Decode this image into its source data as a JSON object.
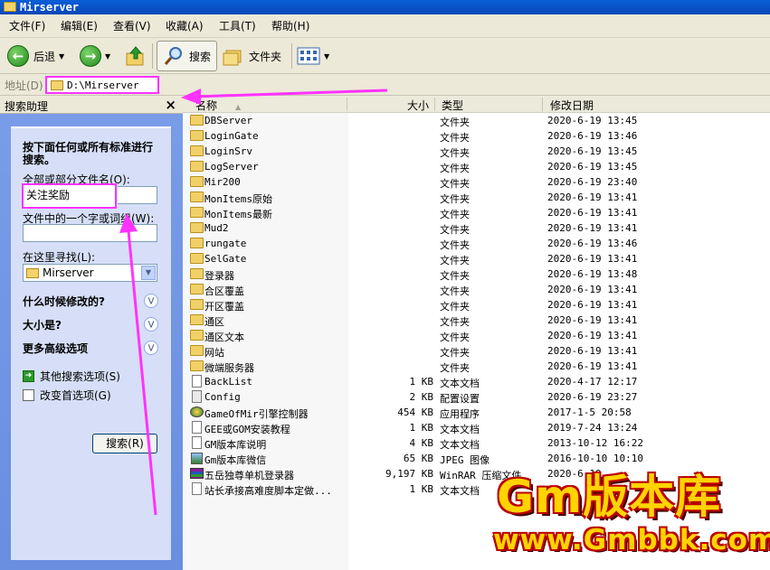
{
  "window": {
    "title": "Mirserver"
  },
  "menu": [
    "文件(F)",
    "编辑(E)",
    "查看(V)",
    "收藏(A)",
    "工具(T)",
    "帮助(H)"
  ],
  "toolbar": {
    "back_label": "后退",
    "search_label": "搜索",
    "folders_label": "文件夹"
  },
  "address": {
    "label": "地址(D)",
    "path": "D:\\Mirserver"
  },
  "search_pane": {
    "title": "搜索助理",
    "close_glyph": "×",
    "intro": "按下面任何或所有标准进行搜索。",
    "filename_label": "全部或部分文件名(O):",
    "filename_value": "关注奖励",
    "phrase_label": "文件中的一个字或词组(W):",
    "phrase_value": "",
    "lookin_label": "在这里寻找(L):",
    "lookin_value": "Mirserver",
    "section_modified": "什么时候修改的?",
    "section_size": "大小是?",
    "section_advanced": "更多高级选项",
    "link_other": "其他搜索选项(S)",
    "link_prefs": "改变首选项(G)",
    "search_button": "搜索(R)"
  },
  "columns": {
    "name": "名称",
    "size": "大小",
    "type": "类型",
    "modified": "修改日期"
  },
  "files": [
    {
      "icon": "folder",
      "name": "DBServer",
      "size": "",
      "type": "文件夹",
      "date": "2020-6-19 13:45"
    },
    {
      "icon": "folder",
      "name": "LoginGate",
      "size": "",
      "type": "文件夹",
      "date": "2020-6-19 13:46"
    },
    {
      "icon": "folder",
      "name": "LoginSrv",
      "size": "",
      "type": "文件夹",
      "date": "2020-6-19 13:45"
    },
    {
      "icon": "folder",
      "name": "LogServer",
      "size": "",
      "type": "文件夹",
      "date": "2020-6-19 13:45"
    },
    {
      "icon": "folder",
      "name": "Mir200",
      "size": "",
      "type": "文件夹",
      "date": "2020-6-19 23:40"
    },
    {
      "icon": "folder",
      "name": "MonItems原始",
      "size": "",
      "type": "文件夹",
      "date": "2020-6-19 13:41"
    },
    {
      "icon": "folder",
      "name": "MonItems最新",
      "size": "",
      "type": "文件夹",
      "date": "2020-6-19 13:41"
    },
    {
      "icon": "folder",
      "name": "Mud2",
      "size": "",
      "type": "文件夹",
      "date": "2020-6-19 13:41"
    },
    {
      "icon": "folder",
      "name": "rungate",
      "size": "",
      "type": "文件夹",
      "date": "2020-6-19 13:46"
    },
    {
      "icon": "folder",
      "name": "SelGate",
      "size": "",
      "type": "文件夹",
      "date": "2020-6-19 13:41"
    },
    {
      "icon": "folder",
      "name": "登录器",
      "size": "",
      "type": "文件夹",
      "date": "2020-6-19 13:48"
    },
    {
      "icon": "folder",
      "name": "合区覆盖",
      "size": "",
      "type": "文件夹",
      "date": "2020-6-19 13:41"
    },
    {
      "icon": "folder",
      "name": "开区覆盖",
      "size": "",
      "type": "文件夹",
      "date": "2020-6-19 13:41"
    },
    {
      "icon": "folder",
      "name": "通区",
      "size": "",
      "type": "文件夹",
      "date": "2020-6-19 13:41"
    },
    {
      "icon": "folder",
      "name": "通区文本",
      "size": "",
      "type": "文件夹",
      "date": "2020-6-19 13:41"
    },
    {
      "icon": "folder",
      "name": "网站",
      "size": "",
      "type": "文件夹",
      "date": "2020-6-19 13:41"
    },
    {
      "icon": "folder",
      "name": "微端服务器",
      "size": "",
      "type": "文件夹",
      "date": "2020-6-19 13:41"
    },
    {
      "icon": "doc",
      "name": "BackList",
      "size": "1 KB",
      "type": "文本文档",
      "date": "2020-4-17 12:17"
    },
    {
      "icon": "cfg",
      "name": "Config",
      "size": "2 KB",
      "type": "配置设置",
      "date": "2020-6-19 23:27"
    },
    {
      "icon": "app",
      "name": "GameOfMir引擎控制器",
      "size": "454 KB",
      "type": "应用程序",
      "date": "2017-1-5 20:58"
    },
    {
      "icon": "doc",
      "name": "GEE或GOM安装教程",
      "size": "1 KB",
      "type": "文本文档",
      "date": "2019-7-24 13:24"
    },
    {
      "icon": "doc",
      "name": "GM版本库说明",
      "size": "4 KB",
      "type": "文本文档",
      "date": "2013-10-12 16:22"
    },
    {
      "icon": "img",
      "name": "Gm版本库微信",
      "size": "65 KB",
      "type": "JPEG 图像",
      "date": "2016-10-10 10:10"
    },
    {
      "icon": "rar",
      "name": "五岳独尊单机登录器",
      "size": "9,197 KB",
      "type": "WinRAR 压缩文件",
      "date": "2020-6-19"
    },
    {
      "icon": "doc",
      "name": "站长承接高难度脚本定做...",
      "size": "1 KB",
      "type": "文本文档",
      "date": ""
    }
  ],
  "watermark": {
    "top": "Gm版本库",
    "bottom": "www.Gmbbk.com"
  },
  "colors": {
    "annotation": "#ff33ff",
    "titlebar": "#0a5fd8",
    "pane": "#6a8ee0"
  }
}
